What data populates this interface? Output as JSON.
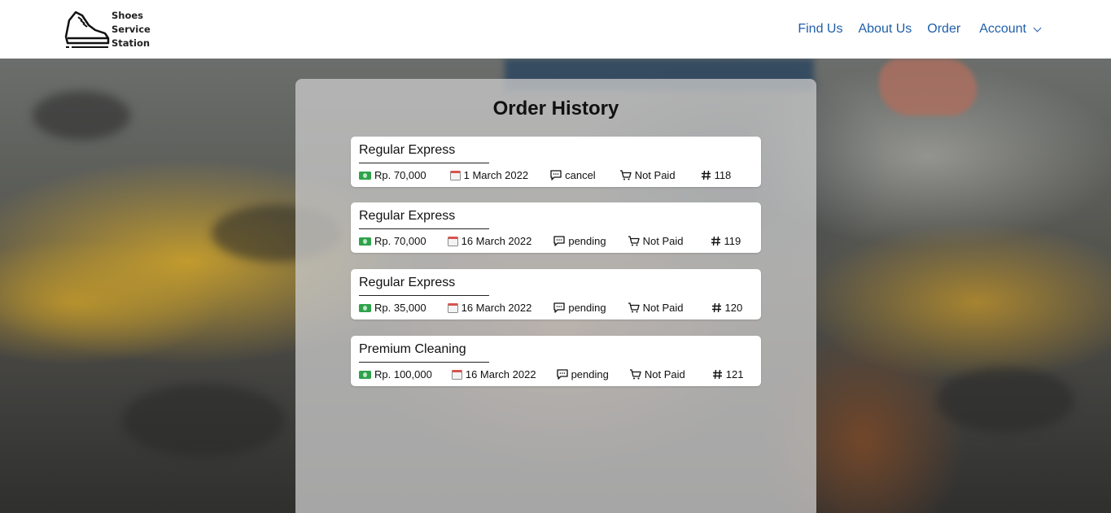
{
  "brand": {
    "line1": "Shoes",
    "line2": "Service",
    "line3": "Station",
    "logo_icon": "sneaker-icon"
  },
  "nav": {
    "find_us": "Find Us",
    "about_us": "About Us",
    "order": "Order",
    "account": "Account"
  },
  "page": {
    "title": "Order History"
  },
  "colors": {
    "link": "#1f5fa8",
    "cash_icon": "#2fa24b",
    "panel": "#c8c8c8"
  },
  "orders": [
    {
      "service": "Regular Express",
      "price": "Rp. 70,000",
      "date": "1 March 2022",
      "status": "cancel",
      "payment": "Not Paid",
      "id": "118"
    },
    {
      "service": "Regular Express",
      "price": "Rp. 70,000",
      "date": "16 March 2022",
      "status": "pending",
      "payment": "Not Paid",
      "id": "119"
    },
    {
      "service": "Regular Express",
      "price": "Rp. 35,000",
      "date": "16 March 2022",
      "status": "pending",
      "payment": "Not Paid",
      "id": "120"
    },
    {
      "service": "Premium Cleaning",
      "price": "Rp. 100,000",
      "date": "16 March 2022",
      "status": "pending",
      "payment": "Not Paid",
      "id": "121"
    }
  ]
}
